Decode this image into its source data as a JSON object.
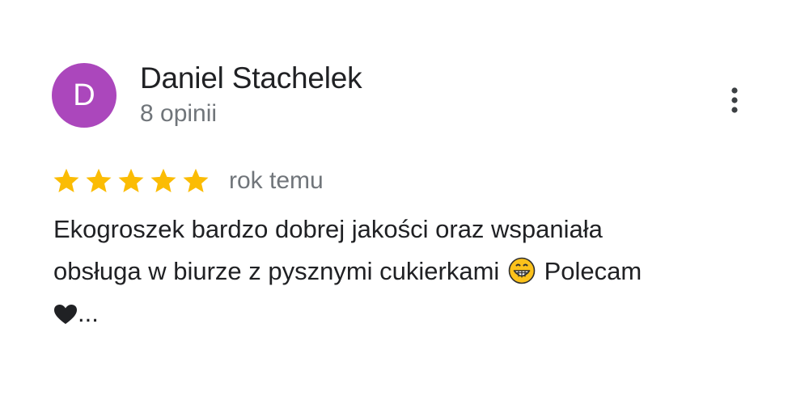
{
  "reviewer": {
    "avatar_initial": "D",
    "avatar_color": "#ab47bc",
    "name": "Daniel Stachelek",
    "review_count": "8 opinii"
  },
  "menu": {
    "icon": "more-vertical-icon"
  },
  "review": {
    "rating": 5,
    "max_rating": 5,
    "star_color": "#fbbc04",
    "time": "rok temu",
    "text_line1": "Ekogroszek bardzo dobrej jakości oraz wspaniała",
    "text_line2_start": "obsługa w biurze z pysznymi cukierkami",
    "emoji_icon": "grinning-face-emoji",
    "text_line2_end": "Polecam",
    "heart_icon": "black-heart-icon",
    "truncation": "..."
  }
}
